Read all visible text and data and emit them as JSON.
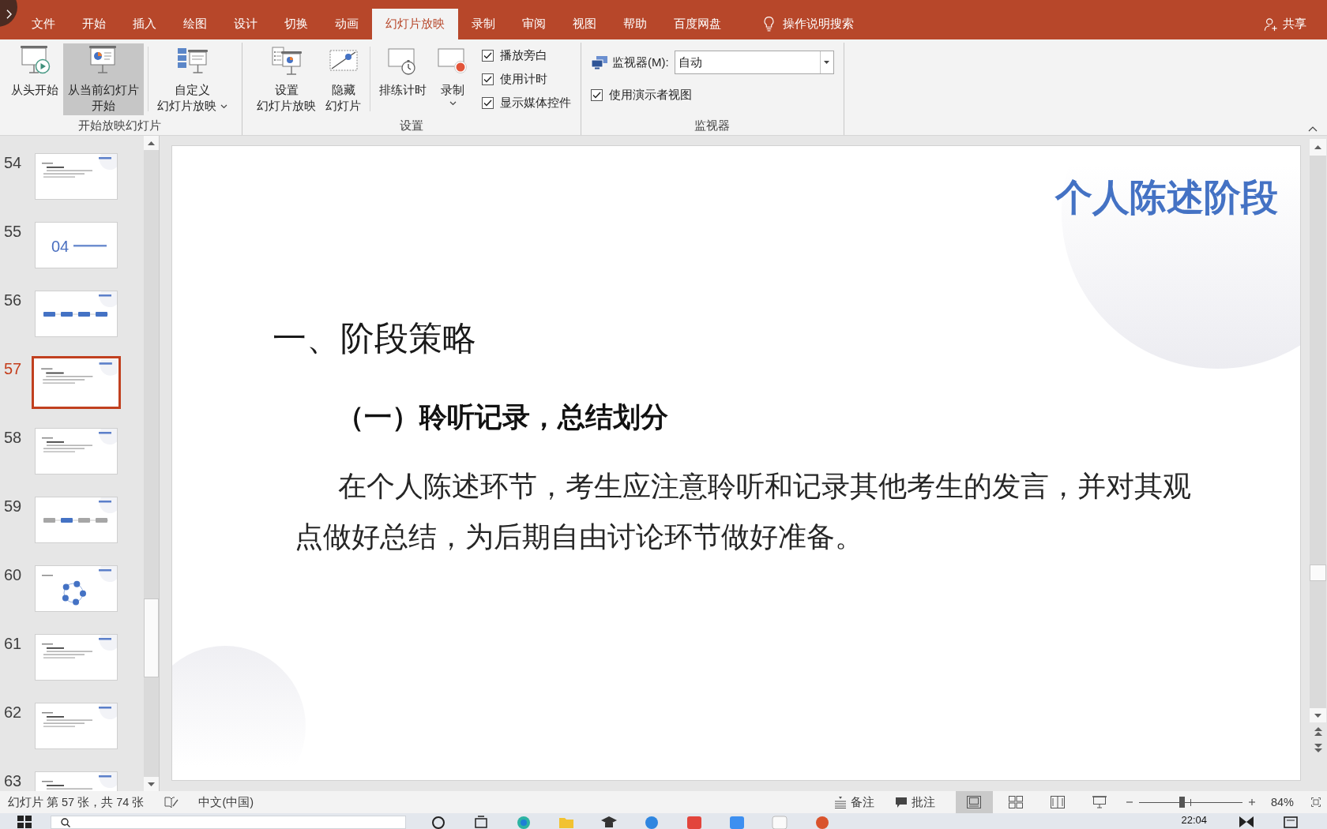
{
  "tabs": [
    {
      "label": "文件",
      "selected": false
    },
    {
      "label": "开始",
      "selected": false
    },
    {
      "label": "插入",
      "selected": false
    },
    {
      "label": "绘图",
      "selected": false
    },
    {
      "label": "设计",
      "selected": false
    },
    {
      "label": "切换",
      "selected": false
    },
    {
      "label": "动画",
      "selected": false
    },
    {
      "label": "幻灯片放映",
      "selected": true
    },
    {
      "label": "录制",
      "selected": false
    },
    {
      "label": "审阅",
      "selected": false
    },
    {
      "label": "视图",
      "selected": false
    },
    {
      "label": "帮助",
      "selected": false
    },
    {
      "label": "百度网盘",
      "selected": false
    }
  ],
  "tell_me": {
    "label": "操作说明搜索"
  },
  "share": {
    "label": "共享"
  },
  "ribbon": {
    "groups": [
      {
        "label": "开始放映幻灯片",
        "items": [
          {
            "kind": "large",
            "lines": [
              "从头开始"
            ],
            "highlighted": false,
            "dropdown": false
          },
          {
            "kind": "large",
            "lines": [
              "从当前幻灯片",
              "开始"
            ],
            "highlighted": true,
            "dropdown": false
          },
          {
            "kind": "divider"
          },
          {
            "kind": "large",
            "lines": [
              "自定义",
              "幻灯片放映"
            ],
            "highlighted": false,
            "dropdown": true
          }
        ]
      },
      {
        "label": "设置",
        "items": [
          {
            "kind": "large",
            "lines": [
              "设置",
              "幻灯片放映"
            ],
            "highlighted": false,
            "dropdown": false
          },
          {
            "kind": "large",
            "lines": [
              "隐藏",
              "幻灯片"
            ],
            "highlighted": false,
            "dropdown": false
          },
          {
            "kind": "divider"
          },
          {
            "kind": "large",
            "lines": [
              "排练计时"
            ],
            "highlighted": false,
            "dropdown": false
          },
          {
            "kind": "large",
            "lines": [
              "录制"
            ],
            "highlighted": false,
            "dropdown": true
          },
          {
            "kind": "checks",
            "options": [
              {
                "label": "播放旁白",
                "checked": true
              },
              {
                "label": "使用计时",
                "checked": true
              },
              {
                "label": "显示媒体控件",
                "checked": true
              }
            ]
          }
        ]
      },
      {
        "label": "监视器",
        "items": [
          {
            "kind": "monitor",
            "label": "监视器(M):",
            "value": "自动",
            "option": {
              "label": "使用演示者视图",
              "checked": true
            }
          }
        ]
      }
    ]
  },
  "thumbnails": {
    "items": [
      {
        "number": "54",
        "kind": "text",
        "selected": false
      },
      {
        "number": "55",
        "kind": "section",
        "label": "04",
        "selected": false
      },
      {
        "number": "56",
        "kind": "flow",
        "selected": false
      },
      {
        "number": "57",
        "kind": "text",
        "selected": true
      },
      {
        "number": "58",
        "kind": "text",
        "selected": false
      },
      {
        "number": "59",
        "kind": "flow-step",
        "selected": false
      },
      {
        "number": "60",
        "kind": "cycle",
        "selected": false
      },
      {
        "number": "61",
        "kind": "text",
        "selected": false
      },
      {
        "number": "62",
        "kind": "text",
        "selected": false
      },
      {
        "number": "63",
        "kind": "text",
        "selected": false
      }
    ]
  },
  "slide": {
    "title": "个人陈述阶段",
    "heading": "一、阶段策略",
    "subheading": "（一）聆听记录，总结划分",
    "paragraph": "在个人陈述环节，考生应注意聆听和记录其他考生的发言，并对其观点做好总结，为后期自由讨论环节做好准备。"
  },
  "status_bar": {
    "slide_info": "幻灯片 第 57 张，共 74 张",
    "language": "中文(中国)",
    "notes": "备注",
    "comments": "批注",
    "views": [
      {
        "selected": true
      },
      {
        "selected": false
      },
      {
        "selected": false
      },
      {
        "selected": false
      }
    ],
    "zoom": {
      "level": 0.41,
      "reading": "84%"
    }
  },
  "taskbar": {
    "clock": "22:04"
  }
}
